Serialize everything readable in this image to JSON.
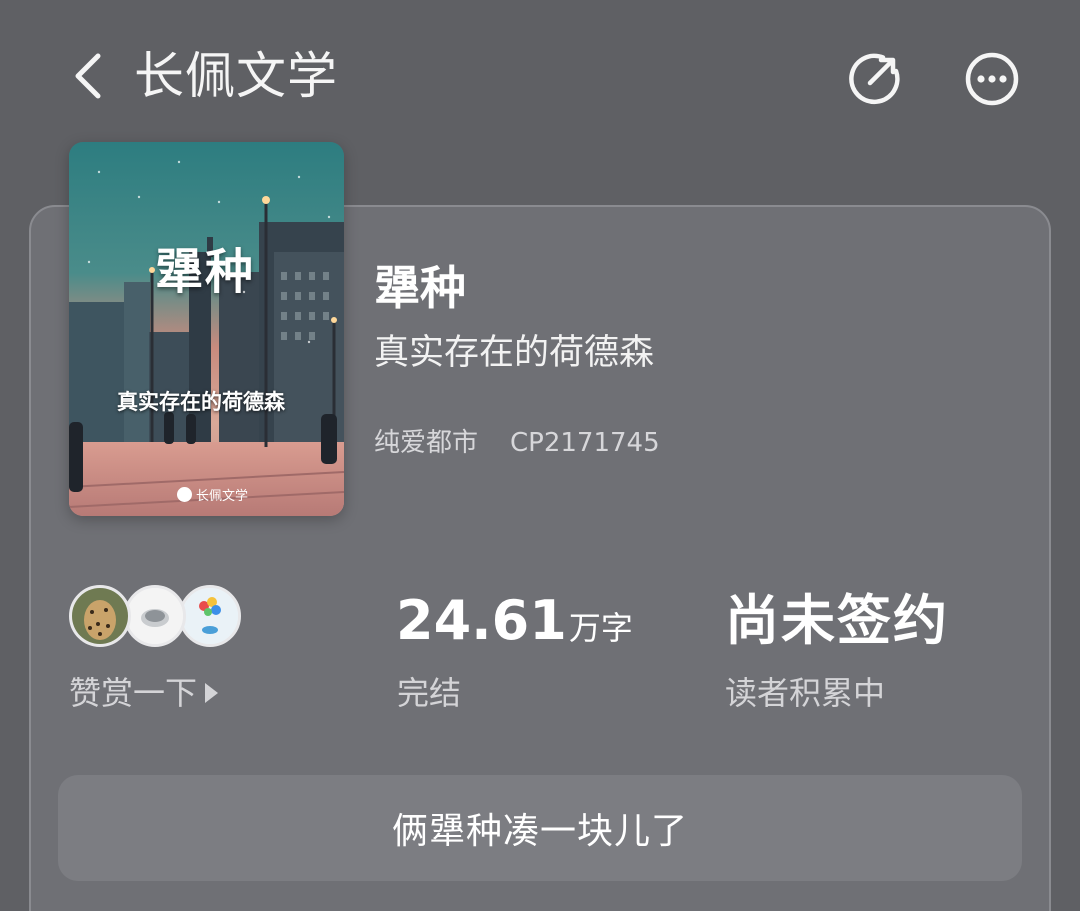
{
  "header": {
    "back_icon": "chevron-left-icon",
    "title": "长佩文学",
    "share_icon": "share-icon",
    "more_icon": "more-icon"
  },
  "book": {
    "cover": {
      "title": "犟种",
      "author": "真实存在的荷德森",
      "logo_text": "长佩文学"
    },
    "title": "犟种",
    "author": "真实存在的荷德森",
    "category": "纯爱都市",
    "cp_code": "CP2171745"
  },
  "stats": {
    "tip_label": "赞赏一下",
    "word_count": "24.61",
    "word_unit": "万字",
    "status": "完结",
    "sign_status": "尚未签约",
    "sign_label": "读者积累中"
  },
  "summary": {
    "text": "俩犟种凑一块儿了"
  },
  "colors": {
    "background": "#5f6064",
    "card": "#6f7075",
    "summary_button": "#7c7d82"
  }
}
